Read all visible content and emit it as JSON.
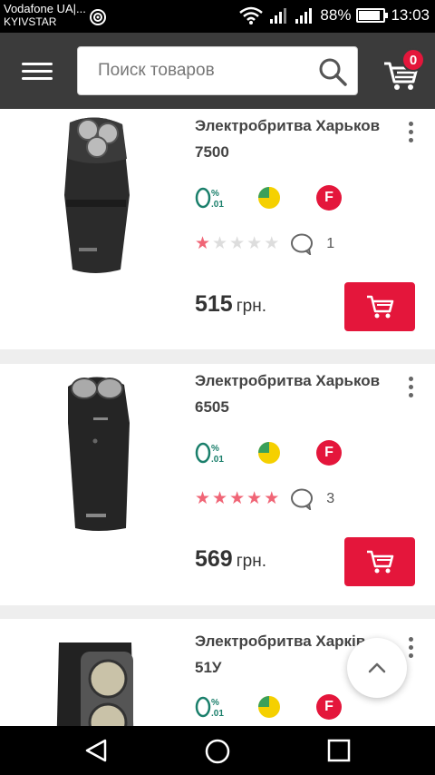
{
  "status_bar": {
    "carrier_line1": "Vodafone UA|...",
    "carrier_line2": "KYIVSTAR",
    "battery_level": "88%",
    "battery_fraction": 0.88,
    "time": "13:03"
  },
  "header": {
    "search_placeholder": "Поиск товаров",
    "cart_count": "0",
    "accent": "#e4163b",
    "background": "#3b3b3b"
  },
  "products": [
    {
      "name": "Электробритва Харьков 7500",
      "rating": 1,
      "reviews": "1",
      "price": "515",
      "currency": "грн."
    },
    {
      "name": "Электробритва Харьков 6505",
      "rating": 5,
      "reviews": "3",
      "price": "569",
      "currency": "грн."
    },
    {
      "name": "Электробритва Харків 51У",
      "rating": null,
      "reviews": null,
      "price": null,
      "currency": null
    }
  ],
  "badges": {
    "credit_icon": "zero-percent-credit-icon",
    "parts_icon": "payment-parts-pie-icon",
    "f_label": "F"
  },
  "icons": {
    "menu": "hamburger-icon",
    "search": "search-icon",
    "cart": "cart-icon",
    "more": "more-vertical-icon",
    "comment": "comment-icon",
    "scroll_top": "chevron-up-icon",
    "back": "back-triangle-icon",
    "home": "home-circle-icon",
    "recent": "recent-square-icon"
  }
}
